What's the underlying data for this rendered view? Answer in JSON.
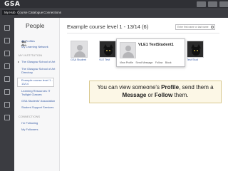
{
  "app": {
    "logo_text": "GSA"
  },
  "menu": [
    {
      "label": "My Hub",
      "active": true
    },
    {
      "label": "Course Catalogue",
      "active": false
    },
    {
      "label": "Connections",
      "active": false
    }
  ],
  "sidebar": {
    "icons": [
      "home-icon",
      "people-icon",
      "calendar-icon",
      "document-icon",
      "message-icon",
      "settings-icon",
      "bookmark-icon",
      "grid-icon"
    ]
  },
  "left_nav": {
    "title": "People",
    "links_top": [
      "All Profiles",
      "My Learning Network"
    ],
    "section_institution": "MY INSTITUTION",
    "institution_items": [
      "The Glasgow School of Art",
      "The Glasgow School of Art",
      "Directory",
      "Example course level 1 -",
      "13/14",
      "Learning Resources IT",
      "Twilight Classes",
      "GSA Students' Association",
      "Student Support Services"
    ],
    "section_connections": "CONNECTIONS",
    "connection_links": [
      "I'm Following",
      "My Followers"
    ]
  },
  "main": {
    "title": "Example course level 1 - 13/14 (6)",
    "search_placeholder": "Enter first name or last name"
  },
  "cards": [
    {
      "label": "GSA Student"
    },
    {
      "label": "VLE Test"
    },
    {
      "label": ""
    },
    {
      "label": ""
    },
    {
      "label": ""
    },
    {
      "label": "Test Stud"
    }
  ],
  "popup": {
    "name": "VLE1 TestStudent1",
    "actions": [
      "View Profile",
      "Send Message",
      "Follow",
      "Block"
    ]
  },
  "callout": {
    "part1": "You can view someone's ",
    "profile": "Profile",
    "part2": ", send them a ",
    "message": "Message",
    "part3": " or ",
    "follow": "Follow",
    "part4": " them."
  }
}
